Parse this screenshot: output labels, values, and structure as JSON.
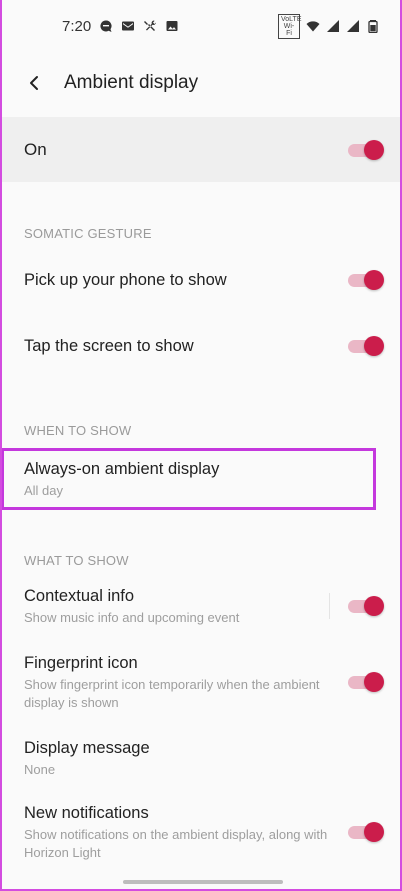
{
  "status": {
    "time": "7:20",
    "volte_top": "VoLTE",
    "volte_bottom": "Wi-Fi"
  },
  "header": {
    "title": "Ambient display"
  },
  "master": {
    "label": "On",
    "enabled": true
  },
  "sections": {
    "somatic": "SOMATIC GESTURE",
    "when": "WHEN TO SHOW",
    "what": "WHAT TO SHOW"
  },
  "rows": {
    "pickup": {
      "title": "Pick up your phone to show",
      "enabled": true
    },
    "tap": {
      "title": "Tap the screen to show",
      "enabled": true
    },
    "always_on": {
      "title": "Always-on ambient display",
      "summary": "All day"
    },
    "contextual": {
      "title": "Contextual info",
      "summary": "Show music info and upcoming event",
      "enabled": true
    },
    "fingerprint": {
      "title": "Fingerprint icon",
      "summary": "Show fingerprint icon temporarily when the ambient display is shown",
      "enabled": true
    },
    "message": {
      "title": "Display message",
      "summary": "None"
    },
    "notifications": {
      "title": "New notifications",
      "summary": "Show notifications on the ambient display, along with Horizon Light",
      "enabled": true
    }
  },
  "colors": {
    "accent": "#cb1d4b",
    "track": "#eab7c6",
    "highlight": "#c438dd"
  }
}
